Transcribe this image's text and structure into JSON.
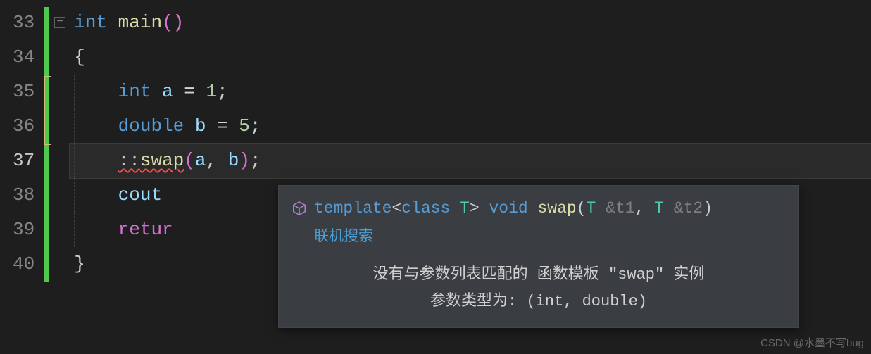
{
  "gutter": {
    "lines": [
      "33",
      "34",
      "35",
      "36",
      "37",
      "38",
      "39",
      "40"
    ],
    "active_index": 4
  },
  "code": {
    "l33": {
      "kw": "int",
      "fn": "main",
      "paren_o": "(",
      "paren_c": ")"
    },
    "l34": {
      "brace": "{"
    },
    "l35": {
      "kw": "int",
      "var": "a",
      "op": " = ",
      "num": "1",
      "semi": ";"
    },
    "l36": {
      "kw": "double",
      "var": "b",
      "op": " = ",
      "num": "5",
      "semi": ";"
    },
    "l37": {
      "scope_err": "::",
      "fn_err": "swap",
      "paren_o": "(",
      "a": "a",
      "comma": ", ",
      "b": "b",
      "paren_c": ")",
      "semi": ";"
    },
    "l38": {
      "txt": "cout "
    },
    "l39": {
      "kw": "retur"
    },
    "l40": {
      "brace": "}"
    }
  },
  "tooltip": {
    "sig": {
      "tmpl_kw": "template",
      "angle_o": "<",
      "class_kw": "class",
      "T": " T",
      "angle_c": "> ",
      "ret": "void",
      "fn": " swap",
      "paren_o": "(",
      "p1t": "T ",
      "p1r": "&",
      "p1n": "t1",
      "comma": ", ",
      "p2t": "T ",
      "p2r": "&",
      "p2n": "t2",
      "paren_c": ")"
    },
    "search_link": "联机搜索",
    "msg_line1": "没有与参数列表匹配的 函数模板 \"swap\" 实例",
    "msg_line2": "参数类型为:  (int, double)"
  },
  "watermark": "CSDN @水墨不写bug"
}
